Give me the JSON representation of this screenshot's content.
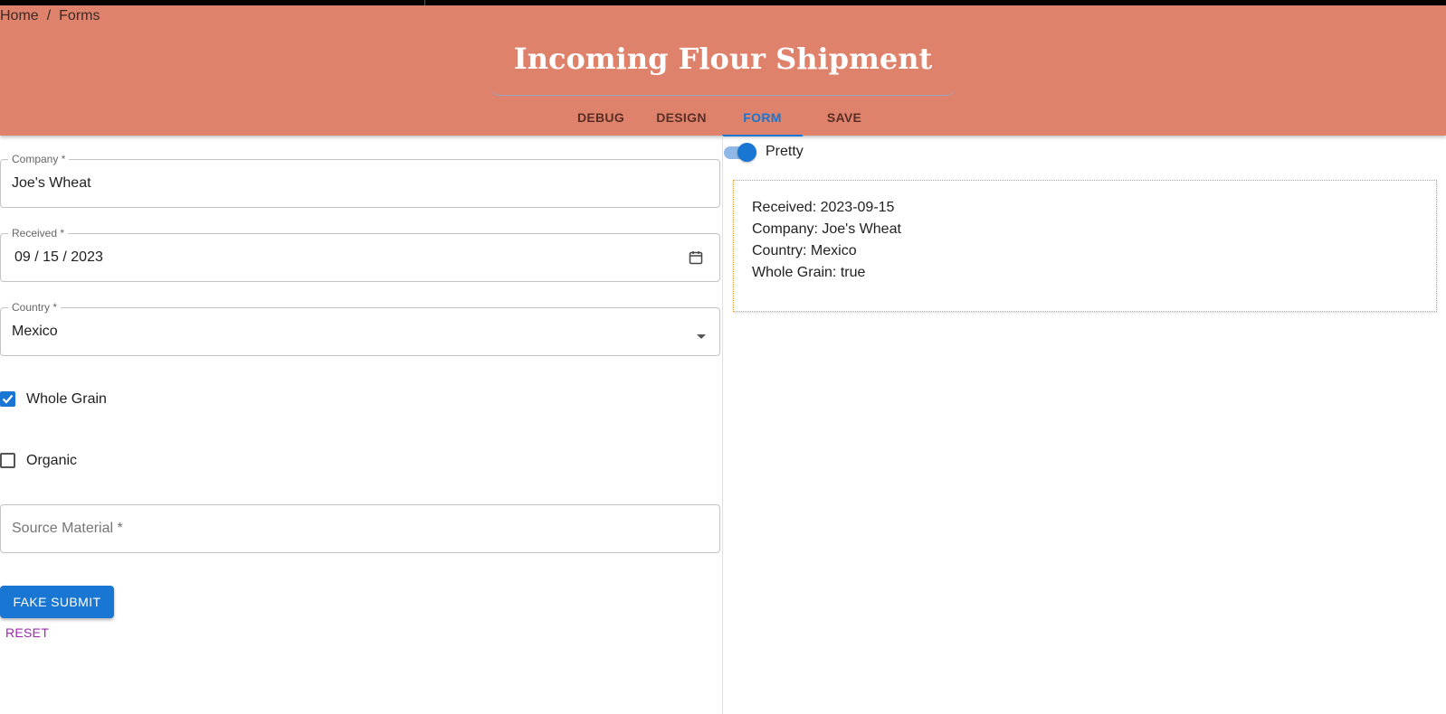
{
  "breadcrumb": {
    "home": "Home",
    "separator": "/",
    "current": "Forms"
  },
  "page_title": "Incoming Flour Shipment",
  "tabs": [
    {
      "label": "DEBUG",
      "active": false
    },
    {
      "label": "DESIGN",
      "active": false
    },
    {
      "label": "FORM",
      "active": true
    },
    {
      "label": "SAVE",
      "active": false
    }
  ],
  "form": {
    "company": {
      "label": "Company *",
      "value": "Joe's Wheat"
    },
    "received": {
      "label": "Received *",
      "value": "09 / 15 / 2023"
    },
    "country": {
      "label": "Country *",
      "value": "Mexico"
    },
    "whole_grain": {
      "label": "Whole Grain",
      "checked": true
    },
    "organic": {
      "label": "Organic",
      "checked": false
    },
    "source_material": {
      "placeholder": "Source Material *"
    },
    "submit_label": "FAKE SUBMIT",
    "reset_label": "RESET"
  },
  "preview": {
    "toggle_label": "Pretty",
    "toggle_on": true,
    "lines": [
      "Received: 2023-09-15",
      "Company: Joe's Wheat",
      "Country: Mexico",
      "Whole Grain: true"
    ]
  },
  "colors": {
    "header_bg": "#de826c",
    "accent": "#1976d2",
    "reset": "#9c27b0",
    "preview_border": "#f0a020"
  }
}
